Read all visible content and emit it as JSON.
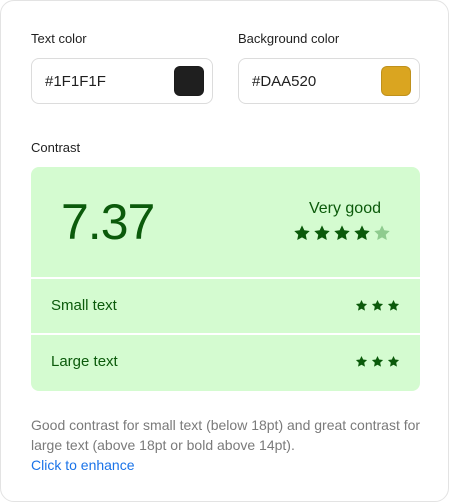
{
  "text_color": {
    "label": "Text color",
    "value": "#1F1F1F",
    "swatch": "#1F1F1F"
  },
  "background_color": {
    "label": "Background color",
    "value": "#DAA520",
    "swatch": "#DAA520"
  },
  "contrast": {
    "label": "Contrast",
    "ratio": "7.37",
    "rating": "Very good",
    "rating_stars": {
      "filled": 4,
      "total": 5
    },
    "rows": [
      {
        "label": "Small text",
        "stars": 3
      },
      {
        "label": "Large text",
        "stars": 3
      }
    ],
    "colors": {
      "panel_bg": "#D4FBD0",
      "accent": "#0B5A0B",
      "star_empty": "#8FCB8F"
    }
  },
  "description": "Good contrast for small text (below 18pt) and great contrast for large text (above 18pt or bold above 14pt).",
  "enhance_link": "Click to enhance",
  "icons": {
    "star": "star-icon"
  }
}
